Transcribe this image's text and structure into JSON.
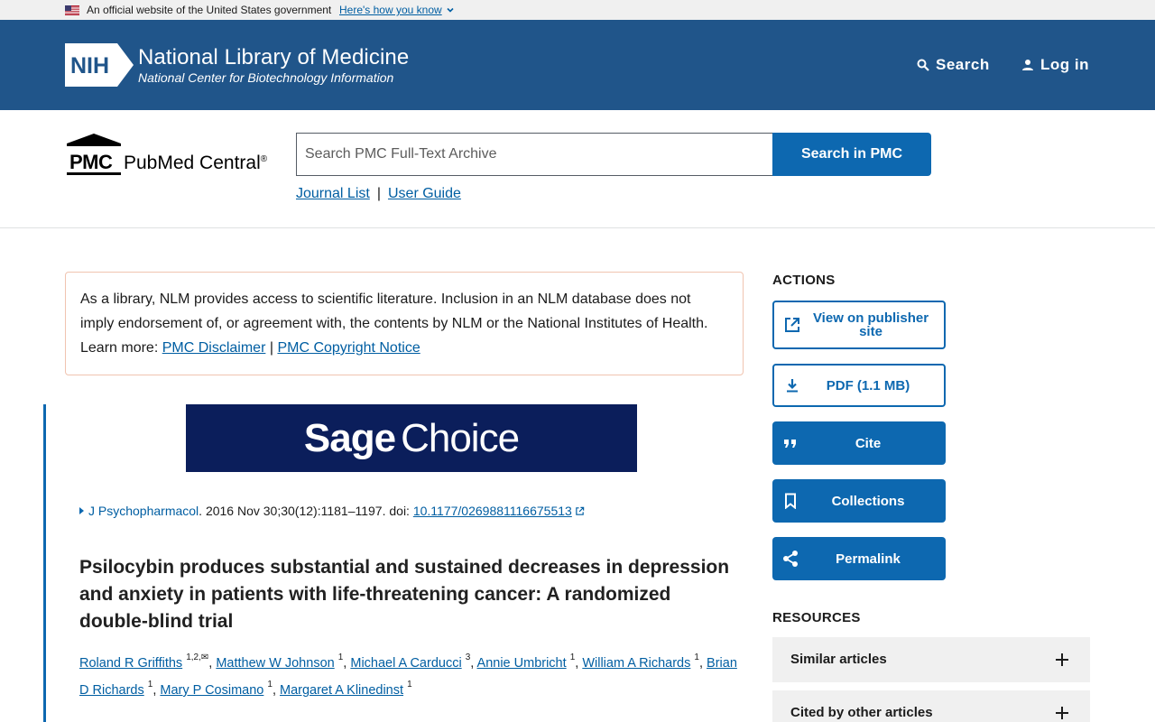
{
  "gov_banner": {
    "text": "An official website of the United States government",
    "link": "Here's how you know"
  },
  "nlm_header": {
    "logo_text": "NIH",
    "title": "National Library of Medicine",
    "subtitle": "National Center for Biotechnology Information",
    "search_label": "Search",
    "login_label": "Log in"
  },
  "pmc_bar": {
    "logo_abbr": "PMC",
    "logo_name": "PubMed Central",
    "logo_reg": "®",
    "search_placeholder": "Search PMC Full-Text Archive",
    "search_button": "Search in PMC",
    "links": [
      "Journal List",
      "User Guide"
    ],
    "link_separator": "|"
  },
  "disclaimer": {
    "text": "As a library, NLM provides access to scientific literature. Inclusion in an NLM database does not imply endorsement of, or agreement with, the contents by NLM or the National Institutes of Health.",
    "learn_more": "Learn more:",
    "link1": "PMC Disclaimer",
    "separator": "|",
    "link2": "PMC Copyright Notice"
  },
  "article": {
    "banner_word1": "Sage",
    "banner_word2": "Choice",
    "journal": "J Psychopharmacol",
    "citation_rest": ". 2016 Nov 30;30(12):1181–1197. doi: ",
    "doi": "10.1177/0269881116675513",
    "title": "Psilocybin produces substantial and sustained decreases in depression and anxiety in patients with life-threatening cancer: A randomized double-blind trial",
    "authors": [
      {
        "name": "Roland R Griffiths",
        "sup": "1,2,✉"
      },
      {
        "name": "Matthew W Johnson",
        "sup": "1"
      },
      {
        "name": "Michael A Carducci",
        "sup": "3"
      },
      {
        "name": "Annie Umbricht",
        "sup": "1"
      },
      {
        "name": "William A Richards",
        "sup": "1"
      },
      {
        "name": "Brian D Richards",
        "sup": "1"
      },
      {
        "name": "Mary P Cosimano",
        "sup": "1"
      },
      {
        "name": "Margaret A Klinedinst",
        "sup": "1"
      }
    ]
  },
  "sidebar": {
    "actions_heading": "ACTIONS",
    "actions": {
      "publisher": "View on publisher site",
      "pdf": "PDF (1.1 MB)",
      "cite": "Cite",
      "collections": "Collections",
      "permalink": "Permalink"
    },
    "resources_heading": "RESOURCES",
    "resources": [
      "Similar articles",
      "Cited by other articles"
    ]
  },
  "colors": {
    "header_blue": "#20558a",
    "primary_button": "#0d68b0",
    "link": "#005ea2",
    "sage_navy": "#0b1e5b"
  }
}
